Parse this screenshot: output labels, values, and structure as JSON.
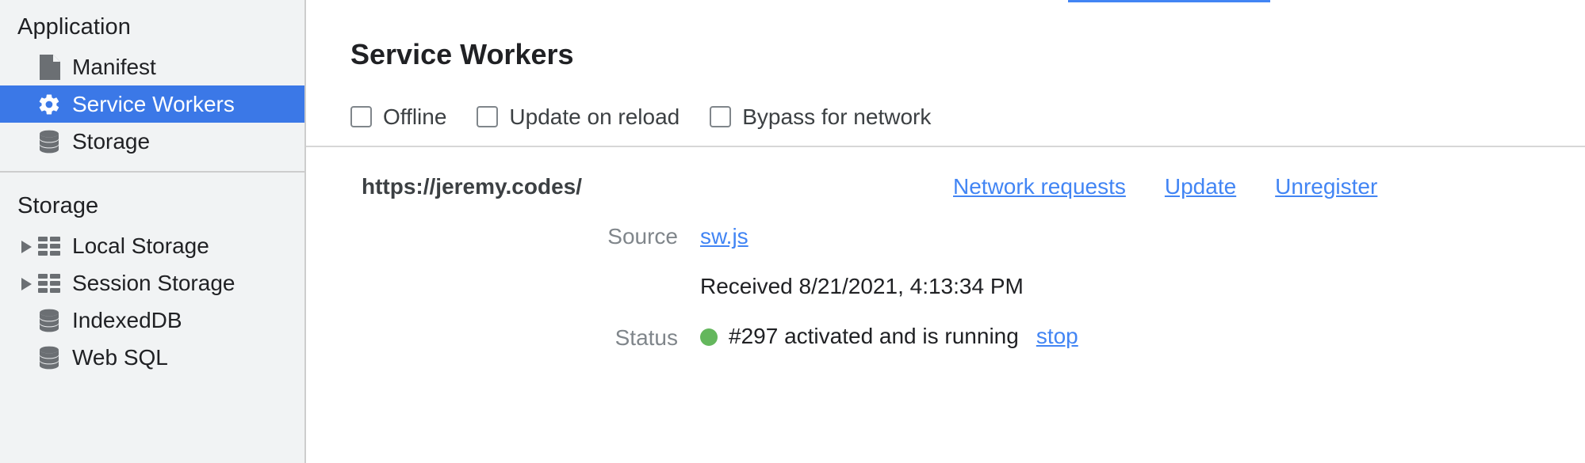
{
  "sidebar": {
    "sections": [
      {
        "title": "Application",
        "items": [
          {
            "label": "Manifest",
            "icon": "document-icon",
            "selected": false,
            "expandable": false
          },
          {
            "label": "Service Workers",
            "icon": "gear-icon",
            "selected": true,
            "expandable": false
          },
          {
            "label": "Storage",
            "icon": "database-icon",
            "selected": false,
            "expandable": false
          }
        ]
      },
      {
        "title": "Storage",
        "items": [
          {
            "label": "Local Storage",
            "icon": "table-icon",
            "selected": false,
            "expandable": true
          },
          {
            "label": "Session Storage",
            "icon": "table-icon",
            "selected": false,
            "expandable": true
          },
          {
            "label": "IndexedDB",
            "icon": "database-icon",
            "selected": false,
            "expandable": false
          },
          {
            "label": "Web SQL",
            "icon": "database-icon",
            "selected": false,
            "expandable": false
          }
        ]
      }
    ]
  },
  "main": {
    "title": "Service Workers",
    "toolbar": {
      "checkboxes": [
        {
          "label": "Offline",
          "checked": false
        },
        {
          "label": "Update on reload",
          "checked": false
        },
        {
          "label": "Bypass for network",
          "checked": false
        }
      ]
    },
    "registration": {
      "scope_url": "https://jeremy.codes/",
      "actions": [
        {
          "label": "Network requests"
        },
        {
          "label": "Update"
        },
        {
          "label": "Unregister"
        }
      ],
      "fields": [
        {
          "label": "Source",
          "link": "sw.js"
        },
        {
          "label": "",
          "text": "Received 8/21/2021, 4:13:34 PM"
        },
        {
          "label": "Status",
          "status_text": "#297 activated and is running",
          "status_color": "#64b75d",
          "action": "stop"
        }
      ]
    }
  },
  "colors": {
    "selection_blue": "#3b78e7",
    "link_blue": "#4285f4",
    "status_green": "#64b75d",
    "sidebar_bg": "#f1f3f4",
    "text_primary": "#202124",
    "text_muted": "#80868b"
  }
}
